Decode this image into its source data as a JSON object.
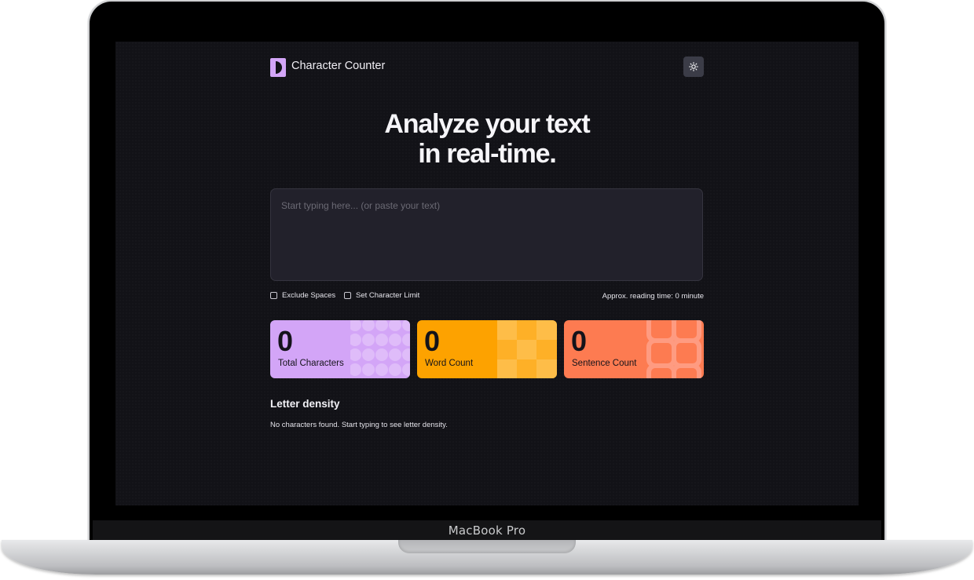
{
  "device": {
    "model_label": "MacBook Pro"
  },
  "header": {
    "brand": "Character Counter",
    "theme_toggle_icon": "sun-icon"
  },
  "hero": {
    "line1": "Analyze your text",
    "line2": "in real-time."
  },
  "editor": {
    "placeholder": "Start typing here... (or paste your text)",
    "value": ""
  },
  "options": {
    "exclude_spaces": {
      "label": "Exclude Spaces",
      "checked": false
    },
    "set_limit": {
      "label": "Set Character Limit",
      "checked": false
    },
    "reading_time": "Approx. reading time: 0 minute"
  },
  "stats": [
    {
      "value": "0",
      "label": "Total Characters",
      "color": "#d3a5f7"
    },
    {
      "value": "0",
      "label": "Word Count",
      "color": "#fda200"
    },
    {
      "value": "0",
      "label": "Sentence Count",
      "color": "#fd7b51"
    }
  ],
  "density": {
    "title": "Letter density",
    "empty_message": "No characters found. Start typing to see letter density."
  },
  "colors": {
    "background": "#121217",
    "accent_purple": "#d3a5f7",
    "accent_orange": "#fda200",
    "accent_coral": "#fd7b51"
  }
}
